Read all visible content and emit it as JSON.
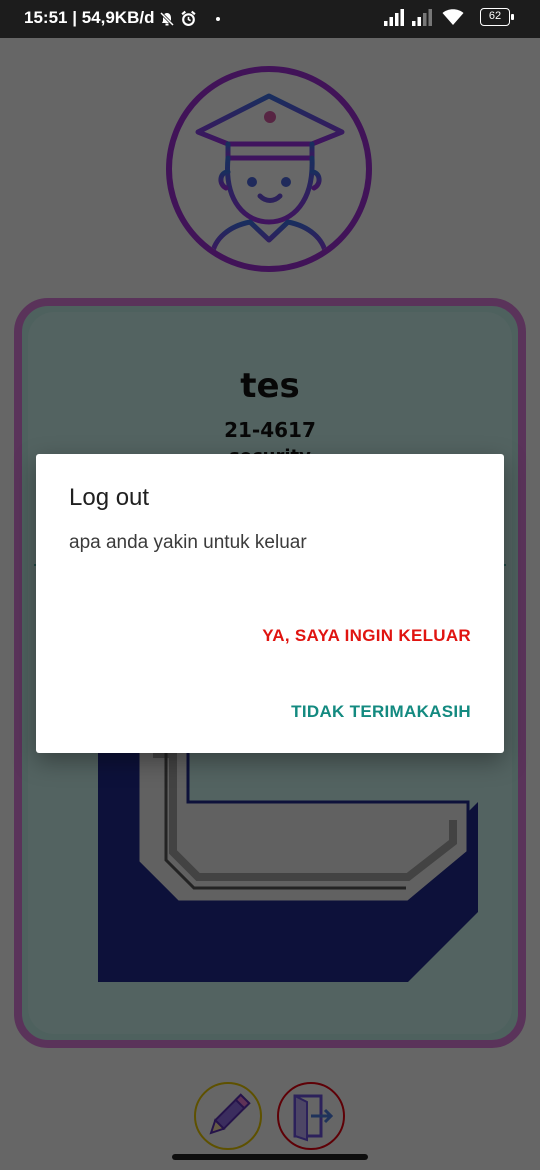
{
  "status_bar": {
    "time": "15:51",
    "network_speed": "54,9KB/d",
    "battery": "62",
    "icons": [
      "mute-bell-icon",
      "alarm-icon",
      "dot-icon",
      "signal-icon",
      "signal-weak-icon",
      "wifi-icon",
      "battery-icon"
    ]
  },
  "profile": {
    "name": "tes",
    "id": "21-4617",
    "role": "security",
    "avatar_icon": "security-officer-icon",
    "accent_colors": {
      "avatar_ring": "#9c2fd1",
      "card_border": "#d77ad6",
      "card_bg": "#c5ede7"
    }
  },
  "actions": {
    "edit_icon": "pencil-icon",
    "logout_icon": "exit-door-icon"
  },
  "dialog": {
    "title": "Log out",
    "message": "apa anda yakin untuk keluar",
    "confirm_label": "YA, SAYA INGIN KELUAR",
    "cancel_label": "TIDAK TERIMAKASIH",
    "confirm_color": "#e01410",
    "cancel_color": "#138a80"
  }
}
